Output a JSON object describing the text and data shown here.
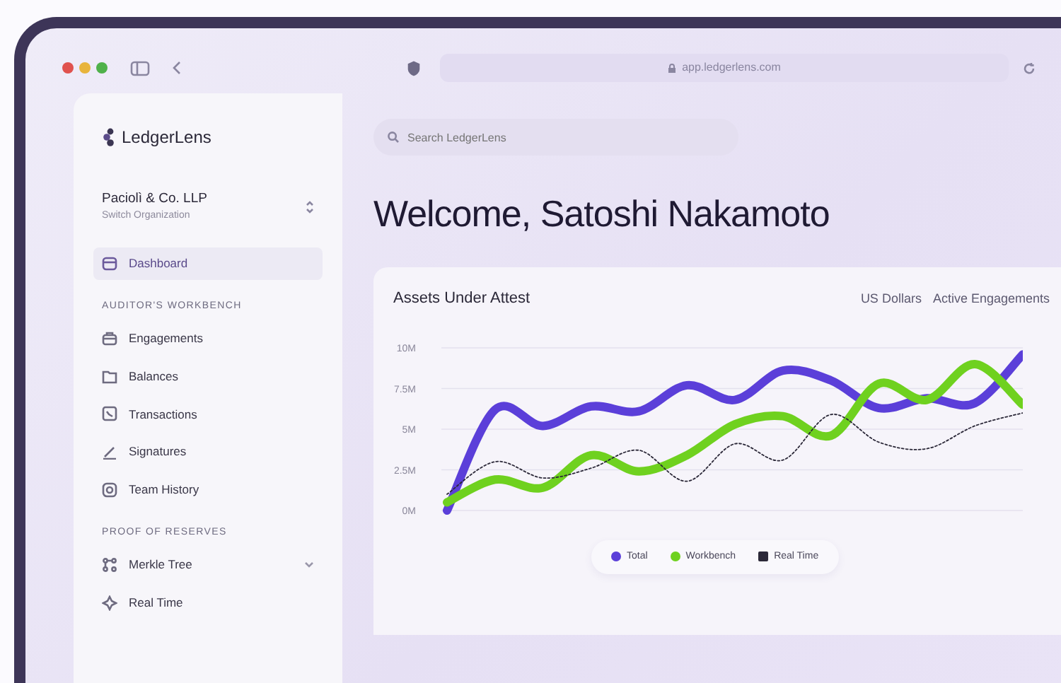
{
  "browser": {
    "url": "app.ledgerlens.com"
  },
  "sidebar": {
    "brand": "LedgerLens",
    "organization": {
      "name": "Paciolì & Co. LLP",
      "subtitle": "Switch Organization"
    },
    "top_items": [
      {
        "label": "Dashboard",
        "selected": true
      }
    ],
    "sections": [
      {
        "heading": "AUDITOR'S WORKBENCH",
        "items": [
          {
            "label": "Engagements",
            "selected": false,
            "has_submenu": false
          },
          {
            "label": "Balances",
            "selected": false,
            "has_submenu": false
          },
          {
            "label": "Transactions",
            "selected": false,
            "has_submenu": false
          },
          {
            "label": "Signatures",
            "selected": false,
            "has_submenu": false
          },
          {
            "label": "Team History",
            "selected": false,
            "has_submenu": false
          }
        ]
      },
      {
        "heading": "PROOF OF RESERVES",
        "items": [
          {
            "label": "Merkle Tree",
            "selected": false,
            "has_submenu": true
          },
          {
            "label": "Real Time",
            "selected": false,
            "has_submenu": false
          }
        ]
      }
    ]
  },
  "search": {
    "placeholder": "Search LedgerLens"
  },
  "heading": "Welcome, Satoshi Nakamoto",
  "chart_card": {
    "title": "Assets Under Attest",
    "filters": [
      "US Dollars",
      "Active Engagements"
    ],
    "chart_data": {
      "type": "line",
      "grid": true,
      "ylim": [
        0,
        10
      ],
      "yticks": [
        {
          "value": 0,
          "label": "0M"
        },
        {
          "value": 2.5,
          "label": "2.5M"
        },
        {
          "value": 5,
          "label": "5M"
        },
        {
          "value": 7.5,
          "label": "7.5M"
        },
        {
          "value": 10,
          "label": "10M"
        }
      ],
      "series": [
        {
          "name": "Total",
          "color": "#5b3fd9",
          "line_style": "solid",
          "values": [
            0,
            6.2,
            5.2,
            6.4,
            6.1,
            7.7,
            6.8,
            8.6,
            8,
            6.3,
            6.9,
            6.6,
            9.6
          ]
        },
        {
          "name": "Workbench",
          "color": "#6fd11f",
          "line_style": "solid",
          "values": [
            0.5,
            1.9,
            1.4,
            3.4,
            2.4,
            3.4,
            5.3,
            5.8,
            4.6,
            7.8,
            6.8,
            9,
            6.5
          ]
        },
        {
          "name": "Real Time",
          "color": "#2b2838",
          "line_style": "dashed",
          "values": [
            1,
            3,
            2,
            2.6,
            3.7,
            1.8,
            4.1,
            3.1,
            5.9,
            4.2,
            3.8,
            5.2,
            6
          ]
        }
      ]
    }
  }
}
